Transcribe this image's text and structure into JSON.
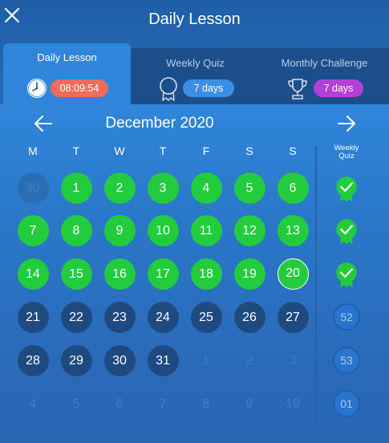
{
  "header": {
    "title": "Daily Lesson",
    "close_icon": "close-icon"
  },
  "tabs": [
    {
      "label": "Daily Lesson",
      "badge": "08:09:54",
      "badge_color": "#f26b5b",
      "icon": "clock-icon",
      "active": true
    },
    {
      "label": "Weekly Quiz",
      "badge": "7 days",
      "badge_color": "#3b8ee6",
      "icon": "medal-icon",
      "active": false
    },
    {
      "label": "Monthly Challenge",
      "badge": "7 days",
      "badge_color": "#b53fd6",
      "icon": "trophy-icon",
      "active": false
    }
  ],
  "calendar": {
    "month": "December 2020",
    "weekdays": [
      "M",
      "T",
      "W",
      "T",
      "F",
      "S",
      "S"
    ],
    "weekly_quiz_header": "Weekly Quiz",
    "rows": [
      [
        {
          "n": "30",
          "s": "prev"
        },
        {
          "n": "1",
          "s": "done"
        },
        {
          "n": "2",
          "s": "done"
        },
        {
          "n": "3",
          "s": "done"
        },
        {
          "n": "4",
          "s": "done"
        },
        {
          "n": "5",
          "s": "done"
        },
        {
          "n": "6",
          "s": "done"
        }
      ],
      [
        {
          "n": "7",
          "s": "done"
        },
        {
          "n": "8",
          "s": "done"
        },
        {
          "n": "9",
          "s": "done"
        },
        {
          "n": "10",
          "s": "done"
        },
        {
          "n": "11",
          "s": "done"
        },
        {
          "n": "12",
          "s": "done"
        },
        {
          "n": "13",
          "s": "done"
        }
      ],
      [
        {
          "n": "14",
          "s": "done"
        },
        {
          "n": "15",
          "s": "done"
        },
        {
          "n": "16",
          "s": "done"
        },
        {
          "n": "17",
          "s": "done"
        },
        {
          "n": "18",
          "s": "done"
        },
        {
          "n": "19",
          "s": "done"
        },
        {
          "n": "20",
          "s": "today"
        }
      ],
      [
        {
          "n": "21",
          "s": "pending"
        },
        {
          "n": "22",
          "s": "pending"
        },
        {
          "n": "23",
          "s": "pending"
        },
        {
          "n": "24",
          "s": "pending"
        },
        {
          "n": "25",
          "s": "pending"
        },
        {
          "n": "26",
          "s": "pending"
        },
        {
          "n": "27",
          "s": "pending"
        }
      ],
      [
        {
          "n": "28",
          "s": "pending"
        },
        {
          "n": "29",
          "s": "pending"
        },
        {
          "n": "30",
          "s": "pending"
        },
        {
          "n": "31",
          "s": "pending"
        },
        {
          "n": "1",
          "s": "next"
        },
        {
          "n": "2",
          "s": "next"
        },
        {
          "n": "3",
          "s": "next"
        }
      ],
      [
        {
          "n": "4",
          "s": "next"
        },
        {
          "n": "5",
          "s": "next"
        },
        {
          "n": "6",
          "s": "next"
        },
        {
          "n": "7",
          "s": "next"
        },
        {
          "n": "8",
          "s": "next"
        },
        {
          "n": "9",
          "s": "next"
        },
        {
          "n": "10",
          "s": "next"
        }
      ]
    ],
    "weekly_quizzes": [
      {
        "label": "",
        "done": true
      },
      {
        "label": "",
        "done": true
      },
      {
        "label": "",
        "done": true
      },
      {
        "label": "52",
        "done": false
      },
      {
        "label": "53",
        "done": false
      },
      {
        "label": "01",
        "done": false
      }
    ]
  }
}
